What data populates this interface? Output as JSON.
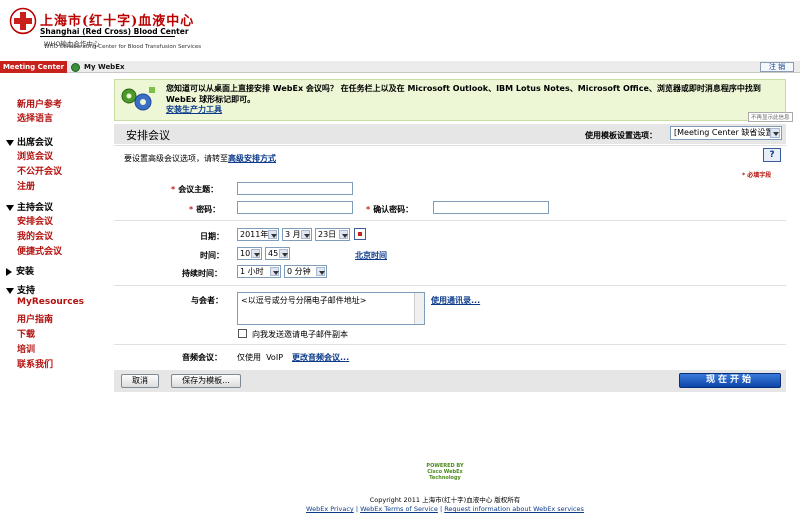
{
  "header": {
    "brand_cn": "上海市(红十字)血液中心",
    "brand_en": "Shanghai (Red Cross) Blood Center",
    "who_cn": "WHO输血合作中心",
    "who_en": "WHO Collaborating Center for Blood Transfusion Services"
  },
  "tabs": {
    "meeting_center": "Meeting Center",
    "my_webex": "My WebEx",
    "logout": "注 销"
  },
  "sidebar": {
    "new_user_ref": "新用户参考",
    "select_language": "选择语言",
    "attend_section": "出席会议",
    "attend_items": [
      "浏览会议",
      "不公开会议",
      "注册"
    ],
    "host_section": "主持会议",
    "host_items": [
      "安排会议",
      "我的会议",
      "便捷式会议"
    ],
    "install_section": "安装",
    "support_section": "支持",
    "support_items": [
      "MyResources",
      "用户指南",
      "下载",
      "培训",
      "联系我们"
    ]
  },
  "banner": {
    "text": "您知道可以从桌面上直接安排 WebEx 会议吗？ 在任务栏上以及在 Microsoft Outlook、IBM Lotus Notes、Microsoft Office、浏览器或即时消息程序中找到 WebEx 球形标记即可。",
    "link": "安装生产力工具",
    "dismiss": "不再显示此信息"
  },
  "form": {
    "title": "安排会议",
    "template_label": "使用模板设置选项：",
    "template_value": "[Meeting Center 缺省设置]",
    "advanced_prefix": "要设置高级会议选项，请转至",
    "advanced_link": "高级安排方式",
    "help": "?",
    "required_note": "* 必填字段",
    "topic_label": "会议主题：",
    "password_label": "密码：",
    "confirm_password_label": "确认密码：",
    "date_label": "日期：",
    "year": "2011年",
    "month": "3 月",
    "day": "23日",
    "time_label": "时间：",
    "hour": "10",
    "minute": "45",
    "timezone_link": "北京时间",
    "duration_label": "持续时间：",
    "duration_hours": "1 小时",
    "duration_minutes": "0 分钟",
    "attendees_label": "与会者：",
    "attendees_value": "<以逗号或分号分隔电子邮件地址>",
    "address_book_link": "使用通讯录...",
    "copy_invite_label": "向我发送邀请电子邮件副本",
    "audio_label": "音频会议：",
    "audio_value": "仅使用  VoIP",
    "audio_change_link": "更改音频会议..."
  },
  "actions": {
    "cancel": "取消",
    "save_template": "保存为模板...",
    "start_now": "现在开始"
  },
  "footer": {
    "powered": "POWERED BY Cisco WebEx Technology",
    "copyright": "Copyright 2011 上海市(红十字)血液中心  版权所有",
    "privacy": "WebEx Privacy",
    "terms": "WebEx Terms of Service",
    "request": "Request information about WebEx services"
  },
  "colors": {
    "brand_red": "#c8201b",
    "link_blue": "#0b3a8a",
    "banner_bg": "#edf7d6",
    "start_blue": "#0c45a8"
  }
}
